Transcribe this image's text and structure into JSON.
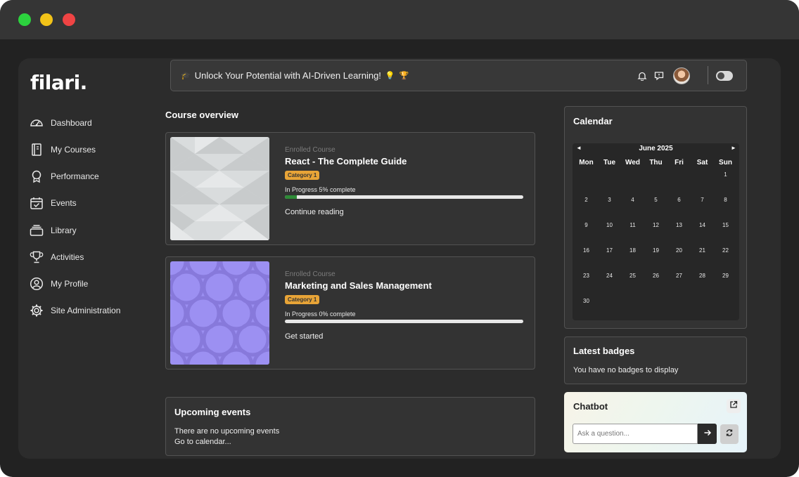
{
  "app": {
    "logo": "filari."
  },
  "sidebar": {
    "items": [
      {
        "label": "Dashboard",
        "icon": "gauge-icon"
      },
      {
        "label": "My Courses",
        "icon": "book-icon"
      },
      {
        "label": "Performance",
        "icon": "award-icon"
      },
      {
        "label": "Events",
        "icon": "calendar-check-icon"
      },
      {
        "label": "Library",
        "icon": "library-stack-icon"
      },
      {
        "label": "Activities",
        "icon": "trophy-icon"
      },
      {
        "label": "My Profile",
        "icon": "user-circle-icon"
      },
      {
        "label": "Site Administration",
        "icon": "gear-icon"
      }
    ]
  },
  "banner": {
    "prefix_emoji": "🎓",
    "text": "Unlock Your Potential with AI-Driven Learning!",
    "suffix_emoji_1": "💡",
    "suffix_emoji_2": "🏆"
  },
  "course_overview": {
    "title": "Course overview",
    "courses": [
      {
        "label": "Enrolled Course",
        "title": "React - The Complete Guide",
        "category": "Category 1",
        "progress_text": "In Progress 5% complete",
        "progress": 5,
        "action": "Continue reading",
        "thumb_color": "#d7dadb"
      },
      {
        "label": "Enrolled Course",
        "title": "Marketing and Sales Management",
        "category": "Category 1",
        "progress_text": "In Progress 0% complete",
        "progress": 0,
        "action": "Get started",
        "thumb_color": "#9b8ff0"
      }
    ]
  },
  "upcoming": {
    "title": "Upcoming events",
    "empty": "There are no upcoming events",
    "link": "Go to calendar..."
  },
  "calendar": {
    "title": "Calendar",
    "month": "June 2025",
    "prev": "◄",
    "next": "►",
    "weekdays": [
      "Mon",
      "Tue",
      "Wed",
      "Thu",
      "Fri",
      "Sat",
      "Sun"
    ],
    "weeks": [
      [
        "",
        "",
        "",
        "",
        "",
        "",
        "1"
      ],
      [
        "2",
        "3",
        "4",
        "5",
        "6",
        "7",
        "8"
      ],
      [
        "9",
        "10",
        "11",
        "12",
        "13",
        "14",
        "15"
      ],
      [
        "16",
        "17",
        "18",
        "19",
        "20",
        "21",
        "22"
      ],
      [
        "23",
        "24",
        "25",
        "26",
        "27",
        "28",
        "29"
      ],
      [
        "30",
        "",
        "",
        "",
        "",
        "",
        ""
      ]
    ]
  },
  "badges": {
    "title": "Latest badges",
    "empty": "You have no badges to display"
  },
  "chatbot": {
    "title": "Chatbot",
    "placeholder": "Ask a question..."
  },
  "colors": {
    "accent_badge": "#e8a437",
    "progress_fill": "#2e8b37"
  }
}
